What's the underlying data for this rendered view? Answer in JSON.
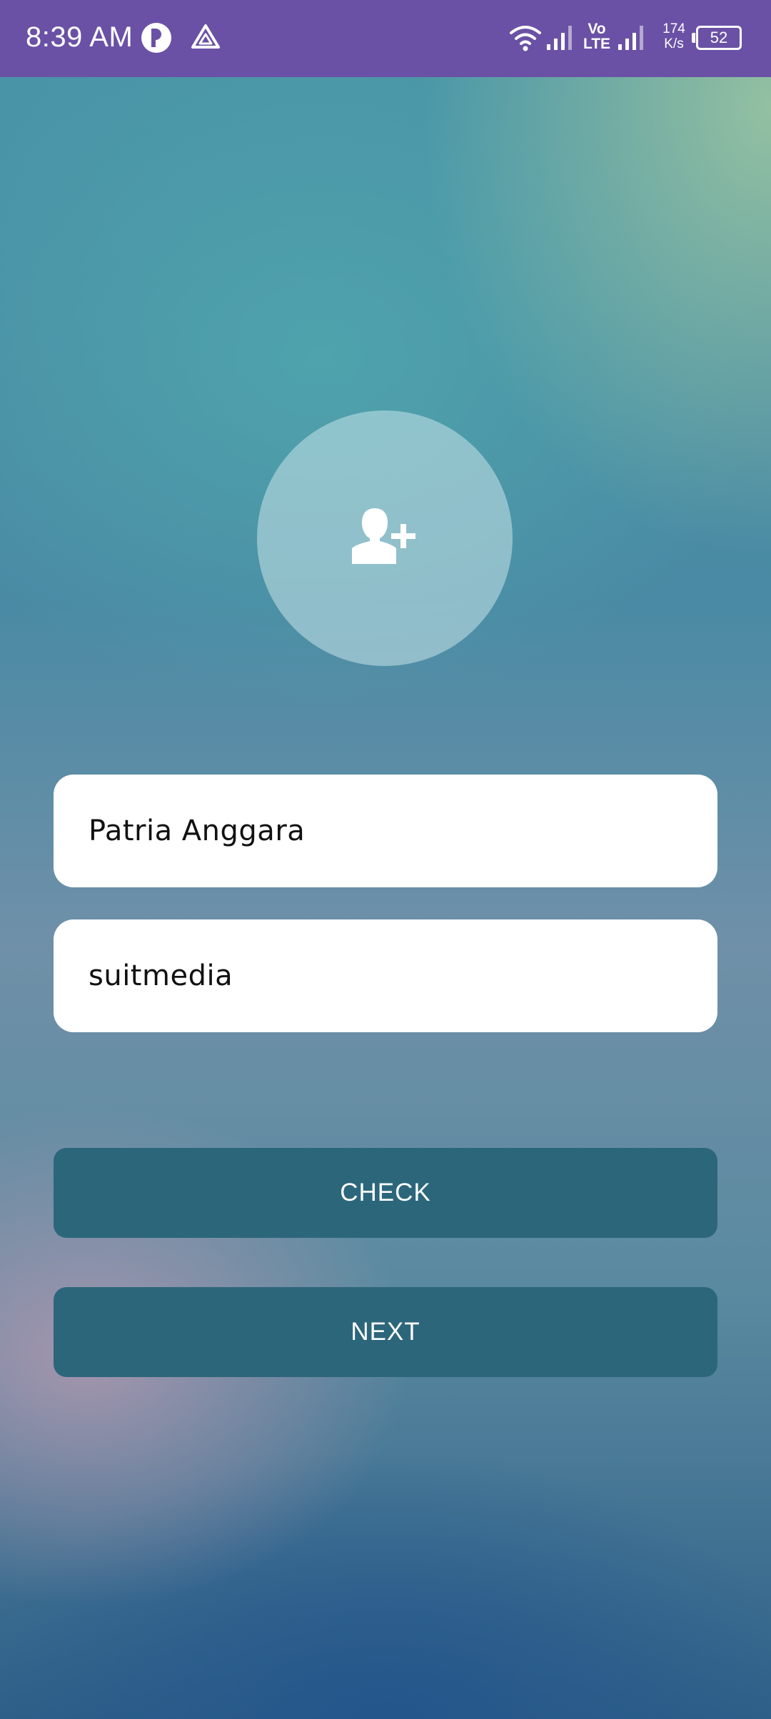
{
  "status_bar": {
    "time": "8:39 AM",
    "volte_top": "Vo",
    "volte_bottom": "LTE",
    "net_speed_value": "174",
    "net_speed_unit": "K/s",
    "battery": "52"
  },
  "avatar": {
    "icon": "add-user-icon"
  },
  "form": {
    "name_value": "Patria Anggara",
    "palindrome_value": "suitmedia"
  },
  "buttons": {
    "check_label": "CHECK",
    "next_label": "NEXT"
  },
  "colors": {
    "status_bar": "#6a51a5",
    "button": "#2c667b",
    "field": "#ffffff"
  }
}
